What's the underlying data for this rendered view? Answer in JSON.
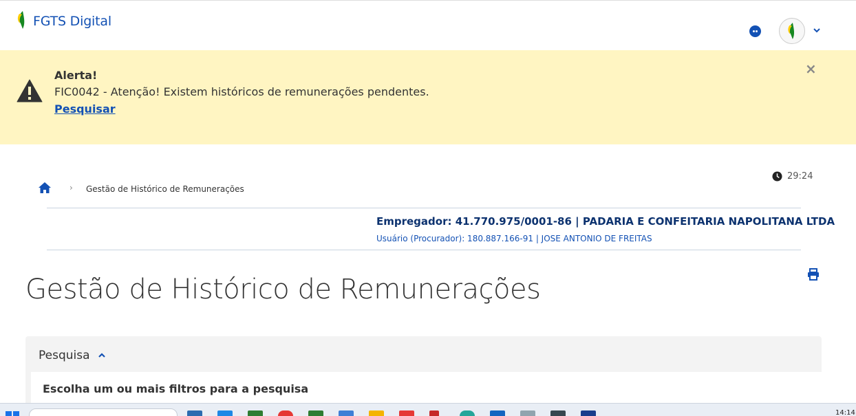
{
  "header": {
    "app_title": "FGTS Digital"
  },
  "alert": {
    "title": "Alerta!",
    "message": "FIC0042 - Atenção! Existem históricos de remunerações pendentes.",
    "link_label": "Pesquisar",
    "close_label": "×"
  },
  "breadcrumb": {
    "separator": "›",
    "current": "Gestão de Histórico de Remunerações"
  },
  "session": {
    "timer": "29:24"
  },
  "context": {
    "employer": "Empregador: 41.770.975/0001-86 | PADARIA E CONFEITARIA NAPOLITANA LTDA",
    "user": "Usuário (Procurador): 180.887.166-91 | JOSE ANTONIO DE FREITAS"
  },
  "page": {
    "title": "Gestão de Histórico de Remunerações"
  },
  "search_panel": {
    "title": "Pesquisa",
    "subtitle": "Escolha um ou mais filtros para a pesquisa"
  },
  "taskbar": {
    "clock": "14:14"
  },
  "colors": {
    "primary": "#1351b4",
    "dark_blue": "#0c326f",
    "alert_bg": "#fff5c2",
    "logo_green": "#168821",
    "logo_yellow": "#ffcd07"
  }
}
